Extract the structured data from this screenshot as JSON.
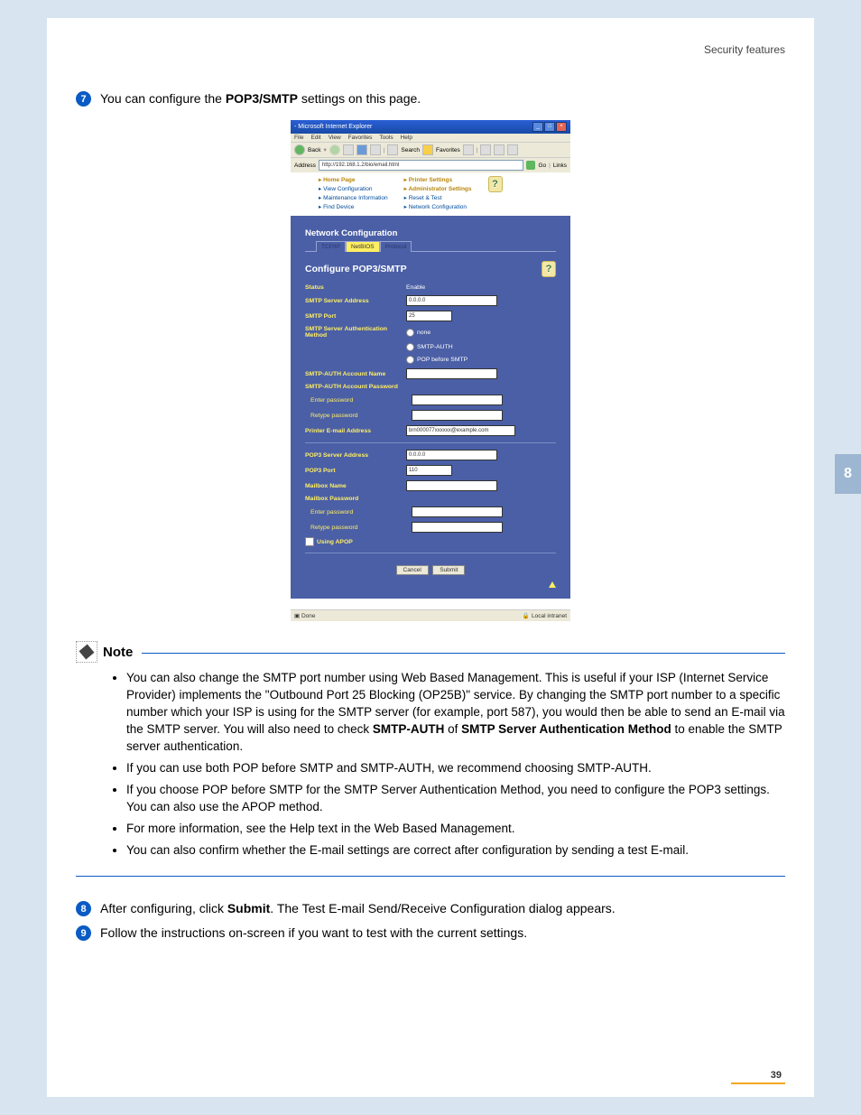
{
  "header": "Security features",
  "step7": {
    "num": "7",
    "prefix": "You can configure the ",
    "bold": "POP3/SMTP",
    "suffix": " settings on this page."
  },
  "browser": {
    "titlebar": " - Microsoft Internet Explorer",
    "menu": [
      "File",
      "Edit",
      "View",
      "Favorites",
      "Tools",
      "Help"
    ],
    "toolbar": {
      "back": "Back",
      "search": "Search",
      "favorites": "Favorites"
    },
    "address_label": "Address",
    "address_value": "http://192.168.1.2/bio/email.html",
    "go": "Go",
    "links": "Links",
    "navleft": [
      "Home Page",
      "View Configuration",
      "Maintenance Information",
      "Find Device"
    ],
    "navright": [
      "Printer Settings",
      "Administrator Settings",
      "Reset & Test",
      "Network Configuration"
    ],
    "section_title": "Network Configuration",
    "tab1": "TCP/IP",
    "tab2": "NetBIOS",
    "tab3": "Protocol",
    "page_title": "Configure POP3/SMTP",
    "rows": {
      "status_l": "Status",
      "status_v": "Enable",
      "smtp_addr_l": "SMTP Server Address",
      "smtp_addr_v": "0.0.0.0",
      "smtp_port_l": "SMTP Port",
      "smtp_port_v": "25",
      "auth_method_l": "SMTP Server Authentication Method",
      "auth_none": "none",
      "auth_smtp": "SMTP-AUTH",
      "auth_pop": "POP before SMTP",
      "acct_name_l": "SMTP-AUTH Account Name",
      "acct_pass_l": "SMTP-AUTH Account Password",
      "enter_pw": "Enter password",
      "retype_pw": "Retype password",
      "email_l": "Printer E-mail Address",
      "email_v": "brn000077xxxxxx@example.com",
      "pop3_addr_l": "POP3 Server Address",
      "pop3_addr_v": "0.0.0.0",
      "pop3_port_l": "POP3 Port",
      "pop3_port_v": "110",
      "mailbox_name_l": "Mailbox Name",
      "mailbox_pass_l": "Mailbox Password",
      "apop": "Using APOP"
    },
    "buttons": {
      "cancel": "Cancel",
      "submit": "Submit"
    },
    "status_done": "Done",
    "status_zone": "Local intranet"
  },
  "note": {
    "label": "Note",
    "items": [
      {
        "p1": "You can also change the SMTP port number using Web Based Management. This is useful if your ISP (Internet Service Provider) implements the \"Outbound Port 25 Blocking (OP25B)\" service. By changing the SMTP port number to a specific number which your ISP is using for the SMTP server (for example, port 587), you would then be able to send an E-mail via the SMTP server. You will also need to check ",
        "b1": "SMTP-AUTH",
        "p2": " of ",
        "b2": "SMTP Server Authentication Method",
        "p3": " to enable the SMTP server authentication."
      },
      {
        "text": "If you can use both POP before SMTP and SMTP-AUTH, we recommend choosing SMTP-AUTH."
      },
      {
        "text": "If you choose POP before SMTP for the SMTP Server Authentication Method, you need to configure the POP3 settings. You can also use the APOP method."
      },
      {
        "text": "For more information, see the Help text in the Web Based Management."
      },
      {
        "text": "You can also confirm whether the E-mail settings are correct after configuration by sending a test E-mail."
      }
    ]
  },
  "step8": {
    "num": "8",
    "prefix": "After configuring, click ",
    "bold": "Submit",
    "suffix": ". The Test E-mail Send/Receive Configuration dialog appears."
  },
  "step9": {
    "num": "9",
    "text": "Follow the instructions on-screen if you want to test with the current settings."
  },
  "sidetab": "8",
  "pagenum": "39"
}
